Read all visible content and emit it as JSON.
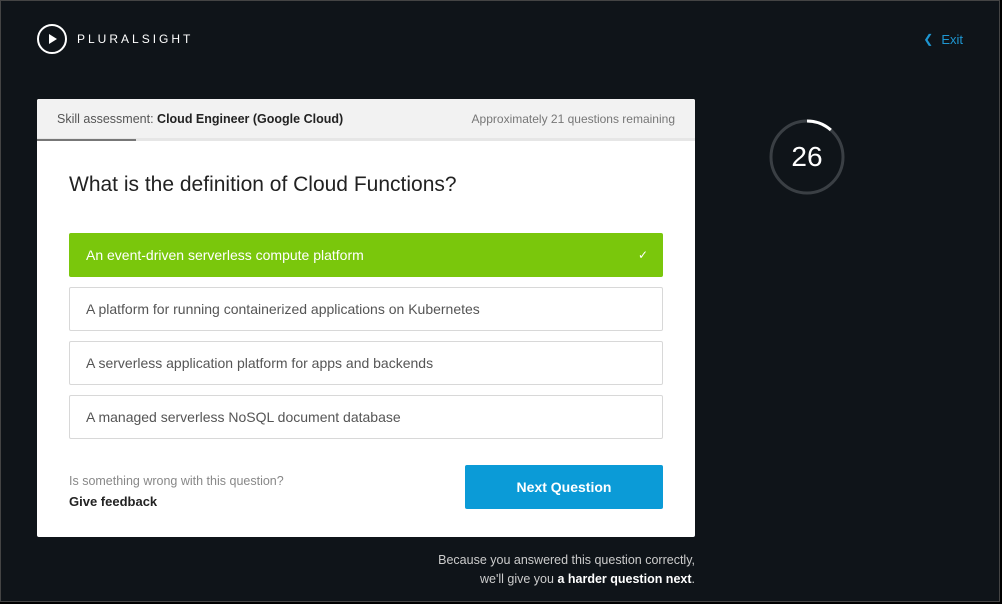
{
  "brand": {
    "name": "PLURALSIGHT"
  },
  "exit": {
    "label": "Exit"
  },
  "header": {
    "prefix": "Skill assessment:",
    "name": "Cloud Engineer (Google Cloud)",
    "remaining": "Approximately 21 questions remaining"
  },
  "question": {
    "text": "What is the definition of Cloud Functions?",
    "options": [
      {
        "text": "An event-driven serverless compute platform",
        "selected": true
      },
      {
        "text": "A platform for running containerized applications on Kubernetes",
        "selected": false
      },
      {
        "text": "A serverless application platform for apps and backends",
        "selected": false
      },
      {
        "text": "A managed serverless NoSQL document database",
        "selected": false
      }
    ]
  },
  "feedback": {
    "prompt": "Is something wrong with this question?",
    "link": "Give feedback"
  },
  "next_button": "Next Question",
  "timer": {
    "seconds": "26"
  },
  "result_note": {
    "line1": "Because you answered this question correctly,",
    "line2_pre": "we'll give you ",
    "line2_bold": "a harder question next",
    "line2_post": "."
  },
  "progress": {
    "percent": 15
  }
}
